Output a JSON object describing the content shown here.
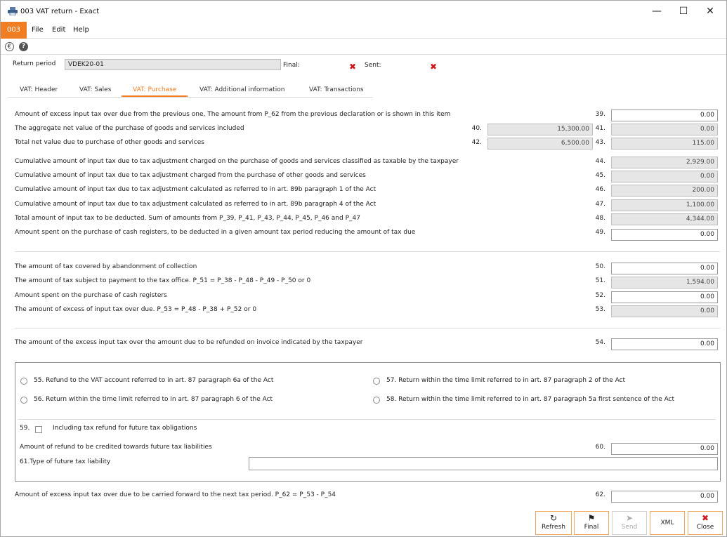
{
  "window": {
    "title": "003 VAT return - Exact",
    "minimize": "—",
    "maximize": "☐",
    "close": "✕"
  },
  "menubar": {
    "badge": "003",
    "items": [
      {
        "label": "File"
      },
      {
        "label": "Edit"
      },
      {
        "label": "Help"
      }
    ]
  },
  "toolstrip": {
    "currency_icon": "€",
    "help_icon": "?"
  },
  "header": {
    "return_period_label": "Return period",
    "return_period_value": "VDEK20-01",
    "final_label": "Final:",
    "sent_label": "Sent:"
  },
  "tabs": [
    {
      "label": "VAT: Header"
    },
    {
      "label": "VAT: Sales"
    },
    {
      "label": "VAT: Purchase"
    },
    {
      "label": "VAT: Additional information"
    },
    {
      "label": "VAT: Transactions"
    }
  ],
  "rows": {
    "r39": {
      "label": "Amount of excess input tax over due from the previous one, The amount from P_62 from the previous declaration or is shown in this item",
      "num": "39.",
      "value": "0.00"
    },
    "r40": {
      "label": "The aggregate net value of the purchase of goods and services included",
      "num40": "40.",
      "value40": "15,300.00",
      "num41": "41.",
      "value41": "0.00"
    },
    "r42": {
      "label": "Total net value due to purchase of other goods and services",
      "num42": "42.",
      "value42": "6,500.00",
      "num43": "43.",
      "value43": "115.00"
    },
    "r44": {
      "label": "Cumulative amount of input tax due to tax adjustment charged on the purchase of goods and services classified as taxable by the taxpayer",
      "num": "44.",
      "value": "2,929.00"
    },
    "r45": {
      "label": "Cumulative amount of input tax due to tax adjustment charged from the purchase of other goods and services",
      "num": "45.",
      "value": "0.00"
    },
    "r46": {
      "label": "Cumulative amount of input tax due to tax adjustment calculated as referred to in art. 89b paragraph 1 of the Act",
      "num": "46.",
      "value": "200.00"
    },
    "r47": {
      "label": "Cumulative amount of input tax due to tax adjustment calculated as referred to in art. 89b paragraph 4 of the Act",
      "num": "47.",
      "value": "1,100.00"
    },
    "r48": {
      "label": "Total amount of input tax to be deducted. Sum of amounts from P_39, P_41, P_43, P_44, P_45, P_46 and P_47",
      "num": "48.",
      "value": "4,344.00"
    },
    "r49": {
      "label": "Amount spent on the purchase of cash registers, to be deducted in a given amount tax period reducing the amount of tax due",
      "num": "49.",
      "value": "0.00"
    },
    "r50": {
      "label": "The amount of tax covered by abandonment of collection",
      "num": "50.",
      "value": "0.00"
    },
    "r51": {
      "label": "The amount of tax subject to payment to the tax office. P_51 = P_38 - P_48 - P_49 - P_50 or 0",
      "num": "51.",
      "value": "1,594.00"
    },
    "r52": {
      "label": "Amount spent on the purchase of cash registers",
      "num": "52.",
      "value": "0.00"
    },
    "r53": {
      "label": "The amount of excess of input tax over due. P_53 = P_48 - P_38 + P_52 or 0",
      "num": "53.",
      "value": "0.00"
    },
    "r54": {
      "label": "The amount of the excess input tax over the amount due to be refunded on invoice indicated by the taxpayer",
      "num": "54.",
      "value": "0.00"
    },
    "r62": {
      "label": "Amount of excess input tax over due to be carried forward to the next tax period. P_62 = P_53 - P_54",
      "num": "62.",
      "value": "0.00"
    }
  },
  "refund": {
    "o55": "55.   Refund to the VAT account referred to in art. 87 paragraph 6a of the Act",
    "o56": "56.   Return within the time limit referred to in art. 87 paragraph 6 of the Act",
    "o57": "57.   Return within the time limit referred to in art. 87 paragraph 2 of the Act",
    "o58": "58.   Return within the time limit referred to in art. 87 paragraph 5a first sentence of the Act",
    "n59": "59.",
    "c59": "Including tax refund for future tax obligations",
    "r60_label": "Amount of refund to be credited towards future tax liabilities",
    "r60_num": "60.",
    "r60_value": "0.00",
    "r61_label": "61.Type of future tax liability",
    "r61_value": ""
  },
  "buttons": {
    "refresh": {
      "icon": "↻",
      "label": "Refresh"
    },
    "final": {
      "icon": "⚑",
      "label": "Final"
    },
    "send": {
      "icon": "➤",
      "label": "Send"
    },
    "xml": {
      "icon": "",
      "label": "XML"
    },
    "close": {
      "icon": "✖",
      "label": "Close"
    }
  },
  "colors": {
    "accent": "#f07d22",
    "cross": "#d0181c",
    "readonly_field": "#e6e6e6"
  }
}
